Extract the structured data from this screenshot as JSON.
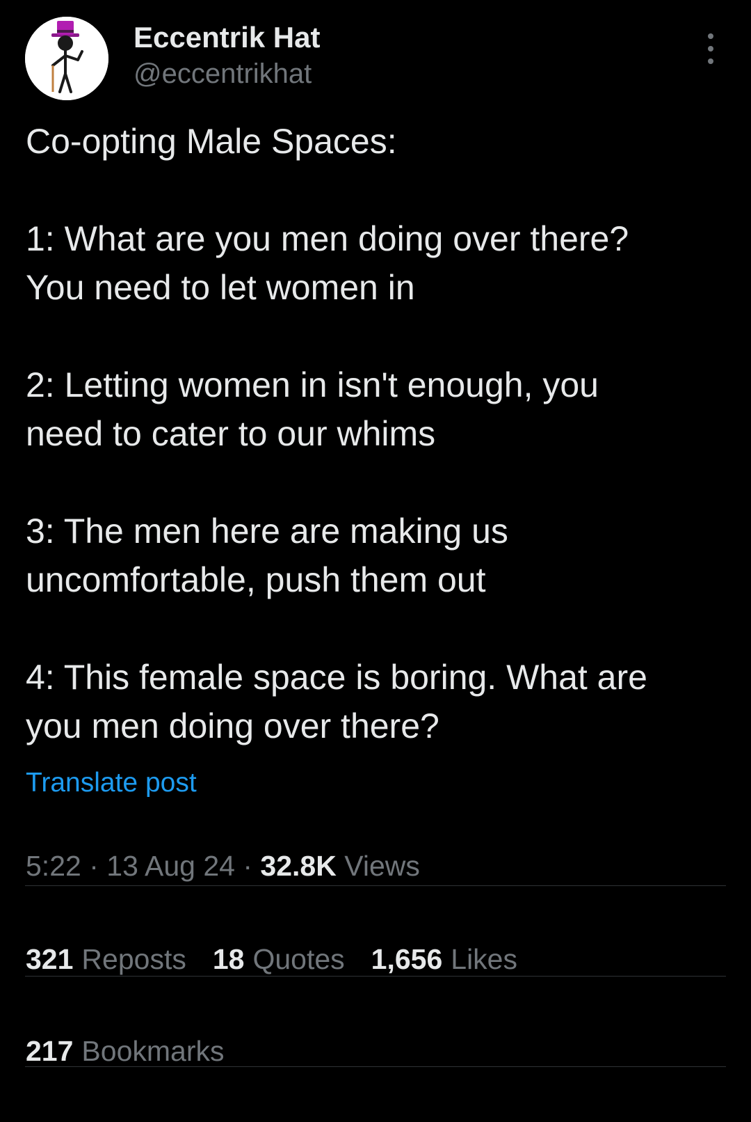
{
  "author": {
    "display_name": "Eccentrik Hat",
    "handle": "@eccentrikhat",
    "avatar_icon": "top-hat-stick-figure-icon"
  },
  "post": {
    "lines": [
      "Co-opting Male Spaces:",
      "",
      "1: What are you men doing over there?",
      "You need to let women in",
      "",
      "2: Letting women in isn't enough, you",
      "need to cater to our whims",
      "",
      "3: The men here are making us",
      "uncomfortable, push them out",
      "",
      "4: This female space is boring. What are",
      "you men doing over there?"
    ],
    "translate_label": "Translate post"
  },
  "meta": {
    "time": "5:22",
    "separator": "·",
    "date": "13 Aug 24",
    "views_count": "32.8K",
    "views_label": "Views"
  },
  "stats": {
    "reposts_count": "321",
    "reposts_label": "Reposts",
    "quotes_count": "18",
    "quotes_label": "Quotes",
    "likes_count": "1,656",
    "likes_label": "Likes",
    "bookmarks_count": "217",
    "bookmarks_label": "Bookmarks"
  },
  "colors": {
    "background": "#000000",
    "text_primary": "#e7e9ea",
    "text_secondary": "#71767b",
    "link": "#1d9bf0",
    "divider": "#2f3336",
    "hat": "#b11db1"
  },
  "icons": {
    "more": "more-vertical-icon"
  }
}
